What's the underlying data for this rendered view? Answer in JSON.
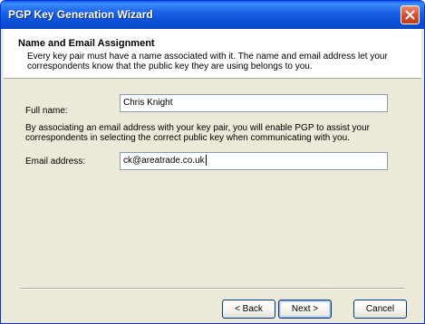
{
  "window": {
    "title": "PGP Key Generation Wizard"
  },
  "header": {
    "title": "Name and Email Assignment",
    "description": "Every key pair must have a name associated with it.  The name and email address let your correspondents know that the public key they are using belongs to you."
  },
  "form": {
    "full_name": {
      "label": "Full name:",
      "value": "Chris Knight"
    },
    "email_info": "By associating an email address with your key pair, you will enable PGP to assist your correspondents in selecting the correct public key when communicating with you.",
    "email": {
      "label": "Email address:",
      "value": "ck@areatrade.co.uk"
    }
  },
  "buttons": {
    "back_label": "< Back",
    "next_label": "Next >",
    "cancel_label": "Cancel"
  },
  "icons": {
    "close": "close-icon"
  }
}
